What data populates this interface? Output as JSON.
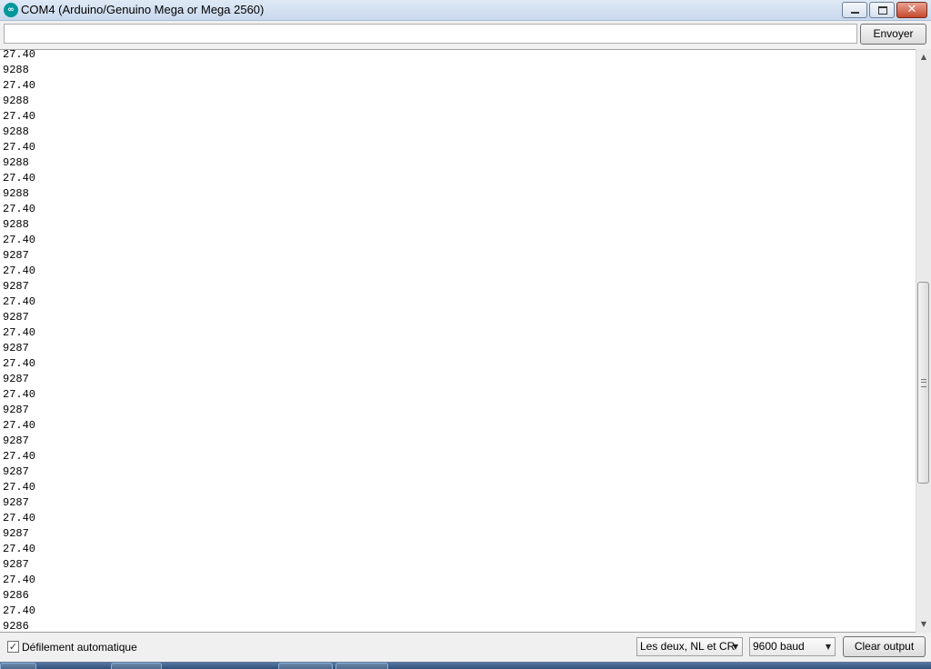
{
  "window": {
    "title": "COM4 (Arduino/Genuino Mega or Mega 2560)",
    "icon": "arduino-icon",
    "close_glyph": "✕"
  },
  "send": {
    "input_value": "",
    "button_label": "Envoyer"
  },
  "serial_output": {
    "lines": [
      "27.40",
      "9288",
      "27.40",
      "9288",
      "27.40",
      "9288",
      "27.40",
      "9288",
      "27.40",
      "9288",
      "27.40",
      "9288",
      "27.40",
      "9287",
      "27.40",
      "9287",
      "27.40",
      "9287",
      "27.40",
      "9287",
      "27.40",
      "9287",
      "27.40",
      "9287",
      "27.40",
      "9287",
      "27.40",
      "9287",
      "27.40",
      "9287",
      "27.40",
      "9287",
      "27.40",
      "9287",
      "27.40",
      "9286",
      "27.40",
      "9286",
      "27.40",
      "9286"
    ]
  },
  "scrollbar": {
    "up_arrow": "▲",
    "down_arrow": "▼"
  },
  "bottom": {
    "autoscroll_checked": true,
    "autoscroll_mark": "✓",
    "autoscroll_label": "Défilement automatique",
    "line_ending_value": "Les deux, NL et CR",
    "baud_value": "9600 baud",
    "caret": "▼",
    "clear_label": "Clear output"
  },
  "colors": {
    "title_gradient_top": "#dfe9f5",
    "close_button": "#c74a2f",
    "arduino_teal": "#00979c"
  }
}
